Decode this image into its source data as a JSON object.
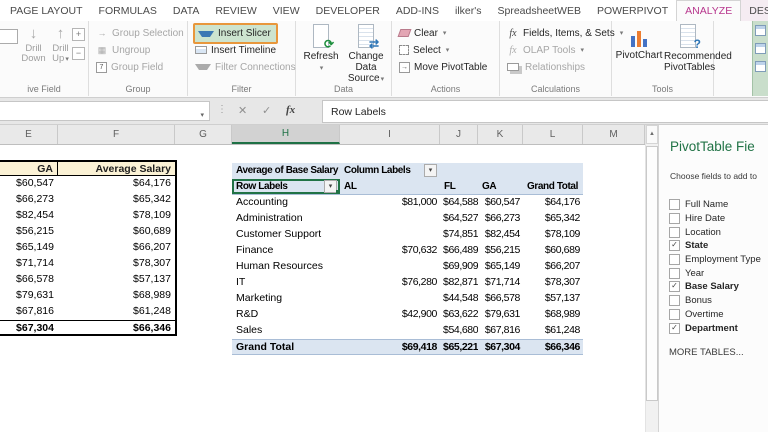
{
  "icons": {
    "dropdown": "▾",
    "drill_down": "↓",
    "drill_up": "↑",
    "group_selection": "→",
    "ungroup": "▦",
    "group_field": "7",
    "move_arrow": "→",
    "refresh": "⟳",
    "swap": "⇄",
    "question": "?",
    "cancel": "✕",
    "enter": "✓",
    "fx": "fx",
    "dots": "⋮",
    "scroll_up": "▲",
    "plus": "+",
    "minus": "−",
    "check": "✓"
  },
  "colors": {
    "analyze_tab": "#B7368D",
    "excel_green": "#217346",
    "slicer_highlight_fill": "#CDE4CF",
    "slicer_highlight_border": "#E8973C",
    "pivot_header_blue": "#DBE5F1",
    "left_table_header_tan": "#FBF2D5"
  },
  "ribbon": {
    "tabs": [
      {
        "label": "PAGE LAYOUT"
      },
      {
        "label": "FORMULAS"
      },
      {
        "label": "DATA"
      },
      {
        "label": "REVIEW"
      },
      {
        "label": "VIEW"
      },
      {
        "label": "DEVELOPER"
      },
      {
        "label": "ADD-INS"
      },
      {
        "label": "ilker's"
      },
      {
        "label": "SpreadsheetWEB"
      },
      {
        "label": "POWERPIVOT"
      },
      {
        "label": "ANALYZE",
        "active": true
      },
      {
        "label": "DESIGN",
        "tint": true
      }
    ],
    "groups": {
      "active_field": {
        "label": "ive Field",
        "drill_down": "Drill Down",
        "drill_up": "Drill Up"
      },
      "group": {
        "label": "Group",
        "items": [
          "Group Selection",
          "Ungroup",
          "Group Field"
        ]
      },
      "filter": {
        "label": "Filter",
        "items": [
          "Insert Slicer",
          "Insert Timeline",
          "Filter Connections"
        ]
      },
      "data": {
        "label": "Data",
        "refresh": "Refresh",
        "change_data_source": [
          "Change Data",
          "Source"
        ]
      },
      "actions": {
        "label": "Actions",
        "items": [
          "Clear",
          "Select",
          "Move PivotTable"
        ]
      },
      "calculations": {
        "label": "Calculations",
        "items": [
          "Fields, Items, & Sets",
          "OLAP Tools",
          "Relationships"
        ]
      },
      "tools": {
        "label": "Tools",
        "pivotchart": "PivotChart",
        "recommended": [
          "Recommended",
          "PivotTables"
        ]
      }
    }
  },
  "formula_bar": {
    "name_box": "",
    "formula": "Row Labels"
  },
  "sheet": {
    "columns": [
      "E",
      "F",
      "G",
      "H",
      "I",
      "J",
      "K",
      "L",
      "M"
    ],
    "selected_column": "H"
  },
  "left_table": {
    "headers": [
      "GA",
      "Average Salary"
    ],
    "rows": [
      [
        "$60,547",
        "$64,176"
      ],
      [
        "$66,273",
        "$65,342"
      ],
      [
        "$82,454",
        "$78,109"
      ],
      [
        "$56,215",
        "$60,689"
      ],
      [
        "$65,149",
        "$66,207"
      ],
      [
        "$71,714",
        "$78,307"
      ],
      [
        "$66,578",
        "$57,137"
      ],
      [
        "$79,631",
        "$68,989"
      ],
      [
        "$67,816",
        "$61,248"
      ]
    ],
    "total": [
      "$67,304",
      "$66,346"
    ]
  },
  "pivot": {
    "value_header": "Average of Base Salary",
    "column_labels": "Column Labels",
    "row_labels": "Row Labels",
    "columns": [
      "AL",
      "FL",
      "GA",
      "Grand Total"
    ],
    "rows": [
      [
        "Accounting",
        "$81,000",
        "$64,588",
        "$60,547",
        "$64,176"
      ],
      [
        "Administration",
        "",
        "$64,527",
        "$66,273",
        "$65,342"
      ],
      [
        "Customer Support",
        "",
        "$74,851",
        "$82,454",
        "$78,109"
      ],
      [
        "Finance",
        "$70,632",
        "$66,489",
        "$56,215",
        "$60,689"
      ],
      [
        "Human Resources",
        "",
        "$69,909",
        "$65,149",
        "$66,207"
      ],
      [
        "IT",
        "$76,280",
        "$82,871",
        "$71,714",
        "$78,307"
      ],
      [
        "Marketing",
        "",
        "$44,548",
        "$66,578",
        "$57,137"
      ],
      [
        "R&D",
        "$42,900",
        "$63,622",
        "$79,631",
        "$68,989"
      ],
      [
        "Sales",
        "",
        "$54,680",
        "$67,816",
        "$61,248"
      ]
    ],
    "grand_total": [
      "Grand Total",
      "$69,418",
      "$65,221",
      "$67,304",
      "$66,346"
    ]
  },
  "fields_panel": {
    "title": "PivotTable Fie",
    "subtitle": "Choose fields to add to",
    "fields": [
      {
        "label": "Full Name",
        "checked": false
      },
      {
        "label": "Hire Date",
        "checked": false
      },
      {
        "label": "Location",
        "checked": false
      },
      {
        "label": "State",
        "checked": true
      },
      {
        "label": "Employment Type",
        "checked": false
      },
      {
        "label": "Year",
        "checked": false
      },
      {
        "label": "Base Salary",
        "checked": true
      },
      {
        "label": "Bonus",
        "checked": false
      },
      {
        "label": "Overtime",
        "checked": false
      },
      {
        "label": "Department",
        "checked": true
      }
    ],
    "more_tables": "MORE TABLES..."
  }
}
